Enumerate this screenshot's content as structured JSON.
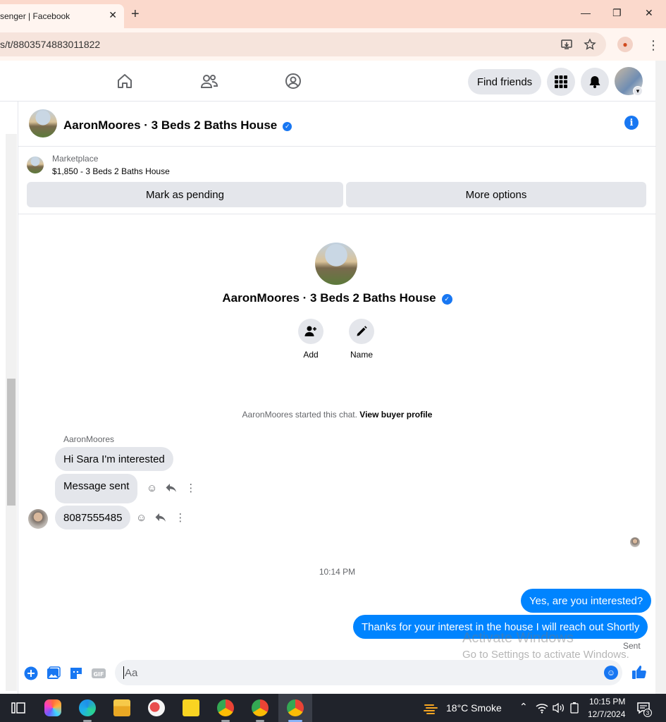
{
  "browser": {
    "tab_title": "senger | Facebook",
    "tab_close": "✕",
    "new_tab": "+",
    "url": "s/t/8803574883011822",
    "minimize": "—",
    "restore": "❐",
    "close": "✕",
    "menu": "⋮"
  },
  "fbnav": {
    "find_friends": "Find friends"
  },
  "chat": {
    "header_title": "AaronMoores · 3 Beds 2 Baths House",
    "marketplace_label": "Marketplace",
    "listing": "$1,850 - 3 Beds 2 Baths House",
    "mark_pending": "Mark as pending",
    "more_options": "More options",
    "intro_title": "AaronMoores · 3 Beds 2 Baths House",
    "action_add": "Add",
    "action_name": "Name",
    "system_prefix": "AaronMoores started this chat. ",
    "system_link": "View buyer profile",
    "sender_name": "AaronMoores",
    "incoming": [
      "Hi Sara I'm interested",
      "Message sent",
      "8087555485"
    ],
    "time_separator": "10:14 PM",
    "outgoing": [
      "Yes, are you interested?",
      "Thanks for your interest in the house I will reach out Shortly"
    ],
    "status": "Sent",
    "composer_placeholder": "Aa",
    "watermark_title": "Activate Windows",
    "watermark_sub": "Go to Settings to activate Windows."
  },
  "taskbar": {
    "weather": "18°C  Smoke",
    "time": "10:15 PM",
    "date": "12/7/2024",
    "notifications": "3"
  },
  "colors": {
    "accent": "#1877f2",
    "outgoing_bubble": "#0084ff",
    "incoming_bubble": "#e4e6eb",
    "tab_strip": "#fbd9cc"
  }
}
